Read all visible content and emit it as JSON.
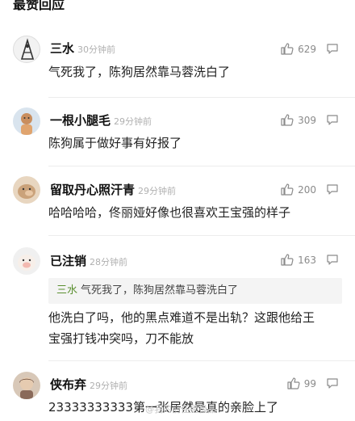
{
  "section": {
    "title": "最赞回应"
  },
  "comments": [
    {
      "name": "三水",
      "time": "30分钟前",
      "likes": "629",
      "text": "气死我了，陈狗居然靠马蓉洗白了"
    },
    {
      "name": "一根小腿毛",
      "time": "29分钟前",
      "likes": "309",
      "text": "陈狗属于做好事有好报了"
    },
    {
      "name": "留取丹心照汗青",
      "time": "29分钟前",
      "likes": "200",
      "text": "哈哈哈哈，佟丽娅好像也很喜欢王宝强的样子"
    },
    {
      "name": "已注销",
      "time": "28分钟前",
      "likes": "163",
      "quote_name": "三水",
      "quote_text": "气死我了，陈狗居然靠马蓉洗白了",
      "text_line1": "他洗白了吗，他的黑点难道不是出轨？这跟他给王",
      "text_line2": "宝强打钱冲突吗，刀不能放"
    },
    {
      "name": "侠布弃",
      "time": "29分钟前",
      "likes": "99",
      "text": "23333333333第一张居然是真的亲脸上了"
    }
  ],
  "watermark": "@我的前任是极品",
  "icons": {
    "like": "thumbs-up-icon",
    "reply": "reply-bubble-icon"
  },
  "colors": {
    "quote_name": "#5a8f2f",
    "time": "#b0b0b0"
  }
}
